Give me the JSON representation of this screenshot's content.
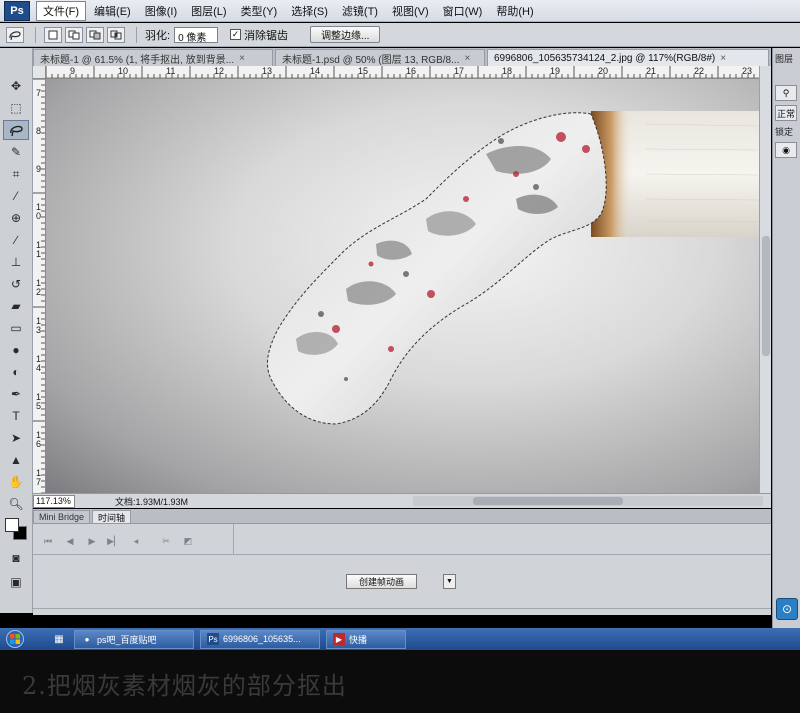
{
  "app": {
    "logo": "Ps"
  },
  "menu": [
    {
      "label": "文件(F)",
      "active": true
    },
    {
      "label": "编辑(E)"
    },
    {
      "label": "图像(I)"
    },
    {
      "label": "图层(L)"
    },
    {
      "label": "类型(Y)"
    },
    {
      "label": "选择(S)"
    },
    {
      "label": "滤镜(T)"
    },
    {
      "label": "视图(V)"
    },
    {
      "label": "窗口(W)"
    },
    {
      "label": "帮助(H)"
    }
  ],
  "options": {
    "feather_label": "羽化:",
    "feather_value": "0 像素",
    "antialias_label": "消除锯齿",
    "antialias_checked": true,
    "refine_edge_label": "调整边缘..."
  },
  "tabs": [
    {
      "label": "未标题-1 @ 61.5% (1, 将手抠出, 放到背景...",
      "close": "×"
    },
    {
      "label": "未标题-1.psd @ 50% (图层 13, RGB/8...",
      "close": "×"
    },
    {
      "label": "6996806_105635734124_2.jpg @ 117%(RGB/8#)",
      "close": "×",
      "active": true
    }
  ],
  "ruler": {
    "top_ticks": [
      "9",
      "10",
      "11",
      "12",
      "13",
      "14",
      "15",
      "16",
      "17",
      "18",
      "19",
      "20",
      "21",
      "22",
      "23"
    ],
    "left_ticks": [
      "7",
      "8",
      "9",
      "1 0",
      "1 1",
      "1 2",
      "1 3",
      "1 4",
      "1 5",
      "1 6",
      "1 7"
    ]
  },
  "status": {
    "zoom": "117.13%",
    "doc_info": "文档:1.93M/1.93M"
  },
  "bottom_panel": {
    "tabs": [
      {
        "label": "Mini Bridge"
      },
      {
        "label": "时间轴",
        "active": true
      }
    ],
    "create_animation": "创建帧动画",
    "dropdown_icon": "▼"
  },
  "right_panel": {
    "label_top": "图层",
    "items": [
      "正常",
      "锁定"
    ]
  },
  "taskbar": {
    "items": [
      {
        "label": "ps吧_百度贴吧",
        "icon": "chrome-icon"
      },
      {
        "label": "6996806_105635...",
        "icon": "photoshop-icon"
      },
      {
        "label": "快播",
        "icon": "player-icon"
      }
    ]
  },
  "caption": "2.把烟灰素材烟灰的部分抠出",
  "colors": {
    "menu_bg": "#dfe4eb",
    "canvas_dark": "#7c7c80",
    "canvas_light": "#f4f4f4",
    "taskbar": "#2f5c9e",
    "foreground": "#ffffff",
    "background": "#000000"
  }
}
